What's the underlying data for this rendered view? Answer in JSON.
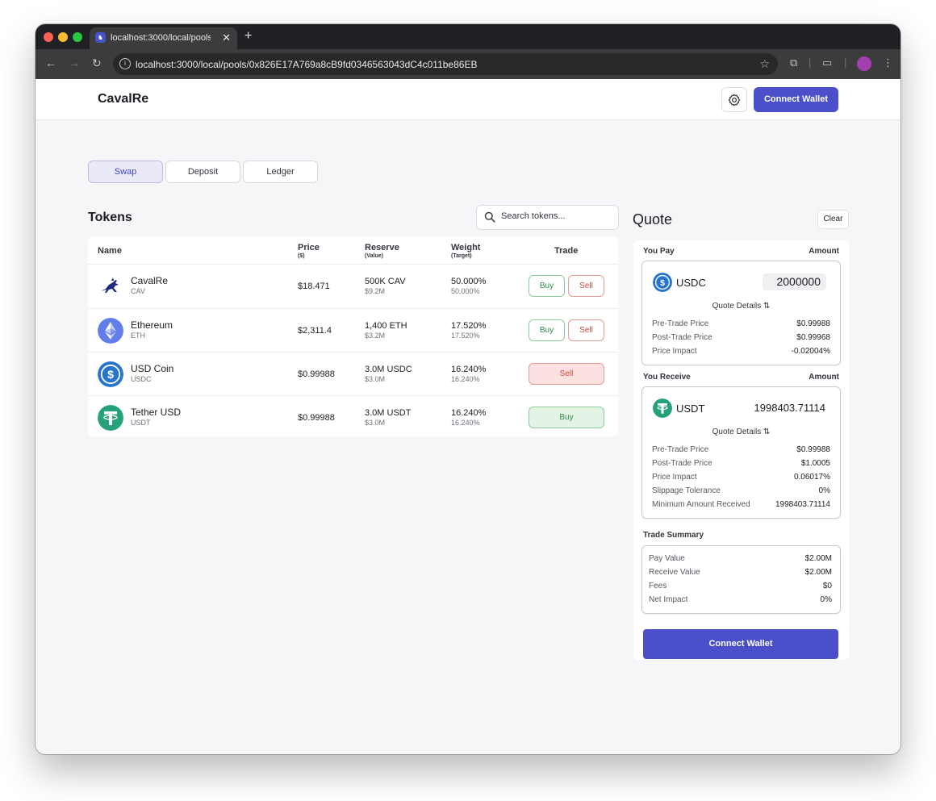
{
  "browser": {
    "tab_title": "localhost:3000/local/pools/0x",
    "url": "localhost:3000/local/pools/0x826E17A769a8cB9fd0346563043dC4c011be86EB"
  },
  "header": {
    "brand": "CavalRe",
    "connect_label": "Connect Wallet"
  },
  "tabs": [
    {
      "label": "Swap",
      "active": true
    },
    {
      "label": "Deposit",
      "active": false
    },
    {
      "label": "Ledger",
      "active": false
    }
  ],
  "tokens": {
    "title": "Tokens",
    "search_placeholder": "Search tokens...",
    "columns": {
      "name": "Name",
      "price": "Price",
      "price_sub": "($)",
      "reserve": "Reserve",
      "reserve_sub": "(Value)",
      "weight": "Weight",
      "weight_sub": "(Target)",
      "trade": "Trade"
    },
    "rows": [
      {
        "name": "CavalRe",
        "symbol": "CAV",
        "price": "$18.471",
        "reserve": "500K CAV",
        "reserve_value": "$9.2M",
        "weight": "50.000%",
        "target": "50.000%",
        "buy": "Buy",
        "sell": "Sell"
      },
      {
        "name": "Ethereum",
        "symbol": "ETH",
        "price": "$2,311.4",
        "reserve": "1,400 ETH",
        "reserve_value": "$3.2M",
        "weight": "17.520%",
        "target": "17.520%",
        "buy": "Buy",
        "sell": "Sell"
      },
      {
        "name": "USD Coin",
        "symbol": "USDC",
        "price": "$0.99988",
        "reserve": "3.0M USDC",
        "reserve_value": "$3.0M",
        "weight": "16.240%",
        "target": "16.240%",
        "sell": "Sell"
      },
      {
        "name": "Tether USD",
        "symbol": "USDT",
        "price": "$0.99988",
        "reserve": "3.0M USDT",
        "reserve_value": "$3.0M",
        "weight": "16.240%",
        "target": "16.240%",
        "buy": "Buy"
      }
    ]
  },
  "quote": {
    "title": "Quote",
    "clear": "Clear",
    "pay": {
      "label": "You Pay",
      "amount_label": "Amount",
      "token": "USDC",
      "amount": "2000000",
      "details": "Quote Details ⇅",
      "rows": [
        {
          "k": "Pre-Trade Price",
          "v": "$0.99988"
        },
        {
          "k": "Post-Trade Price",
          "v": "$0.99968"
        },
        {
          "k": "Price Impact",
          "v": "-0.02004%"
        }
      ]
    },
    "receive": {
      "label": "You Receive",
      "amount_label": "Amount",
      "token": "USDT",
      "amount": "1998403.71114",
      "details": "Quote Details ⇅",
      "rows": [
        {
          "k": "Pre-Trade Price",
          "v": "$0.99988"
        },
        {
          "k": "Post-Trade Price",
          "v": "$1.0005"
        },
        {
          "k": "Price Impact",
          "v": "0.06017%"
        },
        {
          "k": "Slippage Tolerance",
          "v": "0%"
        },
        {
          "k": "Minimum Amount Received",
          "v": "1998403.71114"
        }
      ]
    },
    "summary": {
      "label": "Trade Summary",
      "rows": [
        {
          "k": "Pay Value",
          "v": "$2.00M"
        },
        {
          "k": "Receive Value",
          "v": "$2.00M"
        },
        {
          "k": "Fees",
          "v": "$0"
        },
        {
          "k": "Net Impact",
          "v": "0%"
        }
      ]
    },
    "connect_label": "Connect Wallet"
  },
  "colors": {
    "accent": "#4a50c9",
    "buy": "#2e8a45",
    "sell": "#c8483f",
    "usdc": "#2775ca",
    "usdt": "#26a17b",
    "eth": "#627eea"
  }
}
